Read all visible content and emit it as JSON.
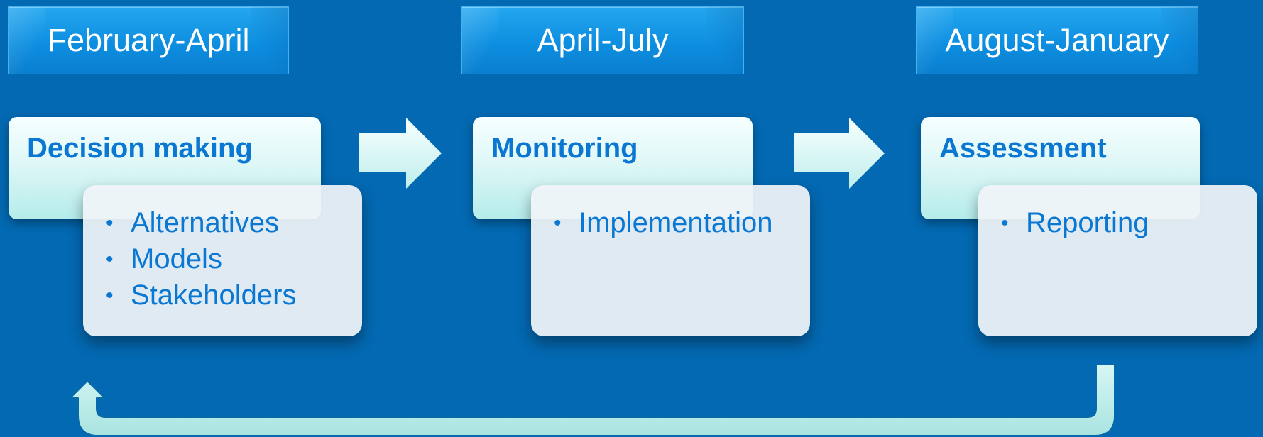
{
  "periods": [
    {
      "label": "February-April"
    },
    {
      "label": "April-July"
    },
    {
      "label": "August-January"
    }
  ],
  "stages": [
    {
      "title": "Decision making",
      "items": [
        "Alternatives",
        "Models",
        "Stakeholders"
      ]
    },
    {
      "title": "Monitoring",
      "items": [
        "Implementation"
      ]
    },
    {
      "title": "Assessment",
      "items": [
        "Reporting"
      ]
    }
  ],
  "colors": {
    "background": "#0369b2",
    "period_fill": "#0d8ee0",
    "stage_title_text": "#0a78d2",
    "arrow_fill": "#c2eeec"
  }
}
